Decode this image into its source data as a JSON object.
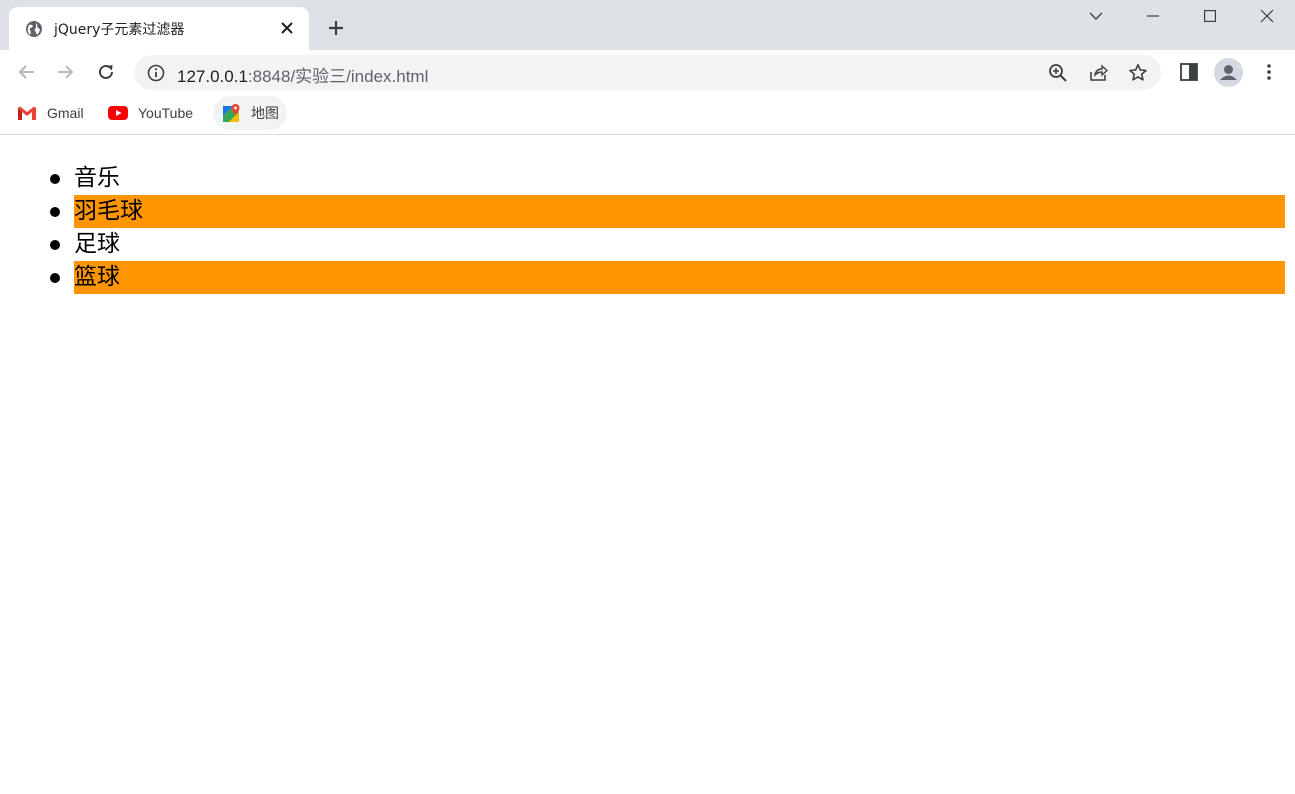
{
  "tab": {
    "title": "jQuery子元素过滤器"
  },
  "address_bar": {
    "url_host": "127.0.0.1",
    "url_rest": ":8848/实验三/index.html"
  },
  "bookmarks": [
    {
      "label": "Gmail",
      "icon": "gmail-icon"
    },
    {
      "label": "YouTube",
      "icon": "youtube-icon"
    },
    {
      "label": "地图",
      "icon": "maps-icon"
    }
  ],
  "page": {
    "items": [
      {
        "label": "音乐",
        "highlighted": false
      },
      {
        "label": "羽毛球",
        "highlighted": true
      },
      {
        "label": "足球",
        "highlighted": false
      },
      {
        "label": "篮球",
        "highlighted": true
      }
    ]
  },
  "colors": {
    "highlight": "#ff9500",
    "tabstrip": "#dee1e6"
  }
}
